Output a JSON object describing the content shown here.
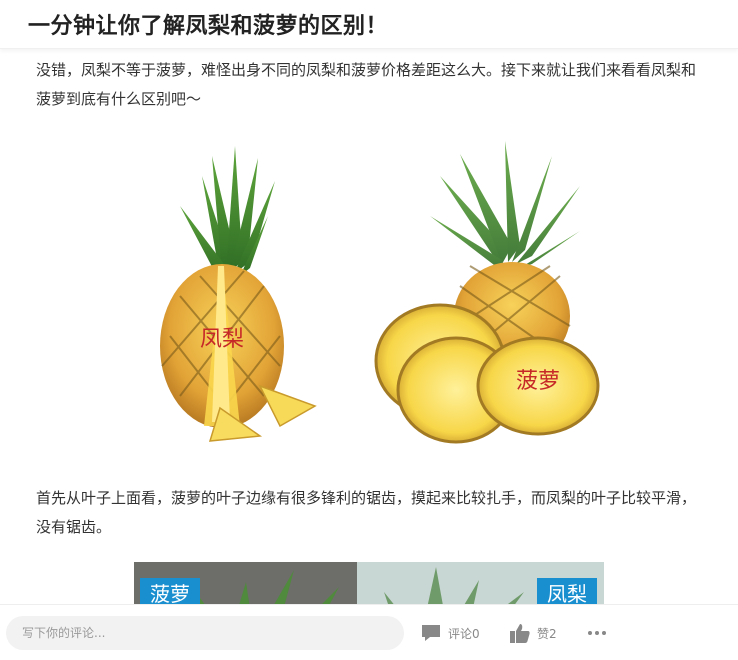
{
  "header": {
    "title": "一分钟让你了解凤梨和菠萝的区别！"
  },
  "article": {
    "paragraph1": "没错，凤梨不等于菠萝，难怪出身不同的凤梨和菠萝价格差距这么大。接下来就让我们来看看凤梨和菠萝到底有什么区别吧～",
    "image1": {
      "left_label": "凤梨",
      "right_label": "菠萝"
    },
    "paragraph2": "首先从叶子上面看，菠萝的叶子边缘有很多锋利的锯齿，摸起来比较扎手，而凤梨的叶子比较平滑，没有锯齿。",
    "image2": {
      "left_label": "菠萝",
      "right_label": "凤梨"
    }
  },
  "bottombar": {
    "comment_placeholder": "写下你的评论...",
    "comment_label": "评论0",
    "like_label": "赞2",
    "more_icon": "more-icon"
  },
  "colors": {
    "label_red": "#c62828",
    "label_blue": "#1a8fd0"
  }
}
